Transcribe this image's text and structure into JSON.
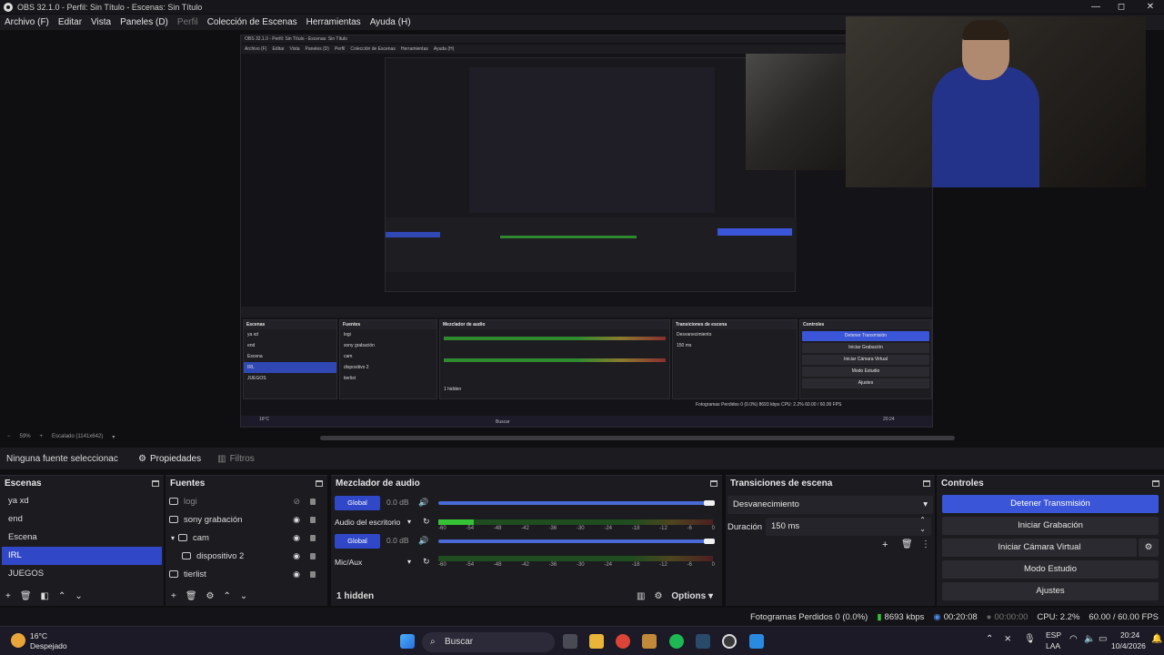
{
  "window": {
    "title": "OBS 32.1.0 - Perfil: Sin Título - Escenas: Sin Título",
    "min": "—",
    "max": "◻",
    "close": "✕"
  },
  "menu": [
    "Archivo (F)",
    "Editar",
    "Vista",
    "Paneles (D)",
    "Perfil",
    "Colección de Escenas",
    "Herramientas",
    "Ayuda (H)"
  ],
  "preview": {
    "zoom": "59%",
    "scaled": "Escalado (1141x642)",
    "nested_title": "OBS 32.1.0 - Perfil: Sin Título - Escenas: Sin Título",
    "nested_menu": [
      "Archivo (F)",
      "Editar",
      "Vista",
      "Paneles (D)",
      "Perfil",
      "Colección de Escenas",
      "Herramientas",
      "Ayuda (H)"
    ]
  },
  "sourcebar": {
    "none": "Ninguna fuente seleccionac",
    "properties": "Propiedades",
    "filters": "Filtros"
  },
  "scenes": {
    "title": "Escenas",
    "items": [
      "ya xd",
      "end",
      "Escena",
      "IRL",
      "JUEGOS"
    ],
    "selected": 3
  },
  "sources": {
    "title": "Fuentes",
    "items": [
      {
        "name": "logi",
        "icon": "camera-icon",
        "hidden": true
      },
      {
        "name": "sony grabación",
        "icon": "camera-icon",
        "hidden": false
      },
      {
        "name": "cam",
        "icon": "folder-icon",
        "hidden": false,
        "group": true
      },
      {
        "name": "dispositivo 2",
        "icon": "camera-icon",
        "hidden": false,
        "child": true
      },
      {
        "name": "tierlist",
        "icon": "window-icon",
        "hidden": false
      }
    ]
  },
  "mixer": {
    "title": "Mezclador de audio",
    "global_label": "Global",
    "channels": [
      {
        "name": "Audio del escritorio",
        "db": "0.0 dB",
        "level": 0.13
      },
      {
        "name": "Mic/Aux",
        "db": "0.0 dB",
        "level": 0
      }
    ],
    "scale": [
      "-60",
      "-54",
      "-48",
      "-42",
      "-36",
      "-30",
      "-24",
      "-18",
      "-12",
      "-6",
      "0"
    ],
    "hidden": "1 hidden",
    "options": "Options"
  },
  "transitions": {
    "title": "Transiciones de escena",
    "selected": "Desvanecimiento",
    "duration_label": "Duración",
    "duration_value": "150 ms"
  },
  "controls": {
    "title": "Controles",
    "buttons": [
      "Detener Transmisión",
      "Iniciar Grabación",
      "Iniciar Cámara Virtual",
      "Modo Estudio",
      "Ajustes"
    ]
  },
  "status": {
    "dropped": "Fotogramas Perdidos 0 (0.0%)",
    "bitrate": "8693 kbps",
    "stream_time": "00:20:08",
    "rec_time": "00:00:00",
    "cpu": "CPU: 2.2%",
    "fps": "60.00 / 60.00 FPS"
  },
  "taskbar": {
    "weather_temp": "16°C",
    "weather_desc": "Despejado",
    "search": "Buscar",
    "lang": "ESP",
    "lang2": "LAA",
    "time": "20:24",
    "date": "10/4/2026"
  },
  "colors": {
    "accent": "#3048c8",
    "button_active": "#3a55d8",
    "panel": "#1b1b20",
    "background": "#0f0f12"
  }
}
